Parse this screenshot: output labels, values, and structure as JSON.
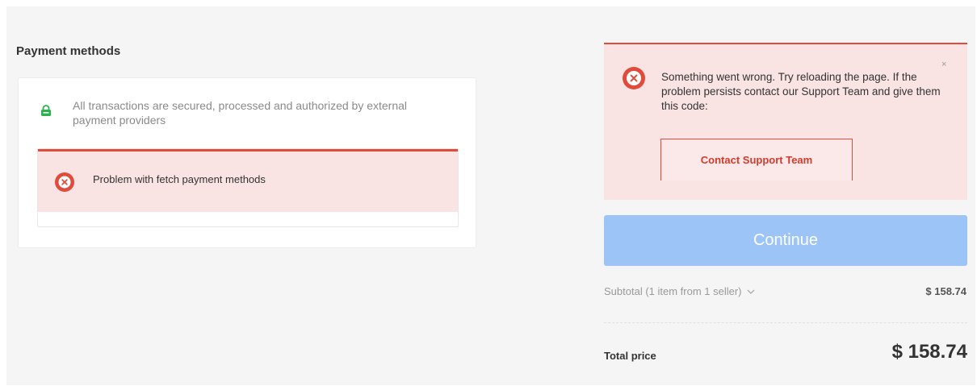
{
  "payment": {
    "title": "Payment methods",
    "secure_text": "All transactions are secured, processed and authorized by external payment providers",
    "error_text": "Problem with fetch payment methods"
  },
  "alert": {
    "message": "Something went wrong. Try reloading the page. If the problem persists contact our Support Team and give them this code:",
    "close_label": "×",
    "button_label": "Contact Support Team"
  },
  "checkout": {
    "continue_label": "Continue",
    "subtotal_label": "Subtotal (1 item from 1 seller)",
    "subtotal_value": "$ 158.74",
    "total_label": "Total price",
    "total_value": "$ 158.74"
  },
  "colors": {
    "error_red": "#e04b3c",
    "error_bg": "#f9e3e3",
    "secure_green": "#2bb24c",
    "continue_blue": "#9cc4f7"
  },
  "icons": {
    "lock": "lock-icon",
    "error": "error-circle-icon",
    "close": "close-icon",
    "chevron": "chevron-down-icon"
  }
}
